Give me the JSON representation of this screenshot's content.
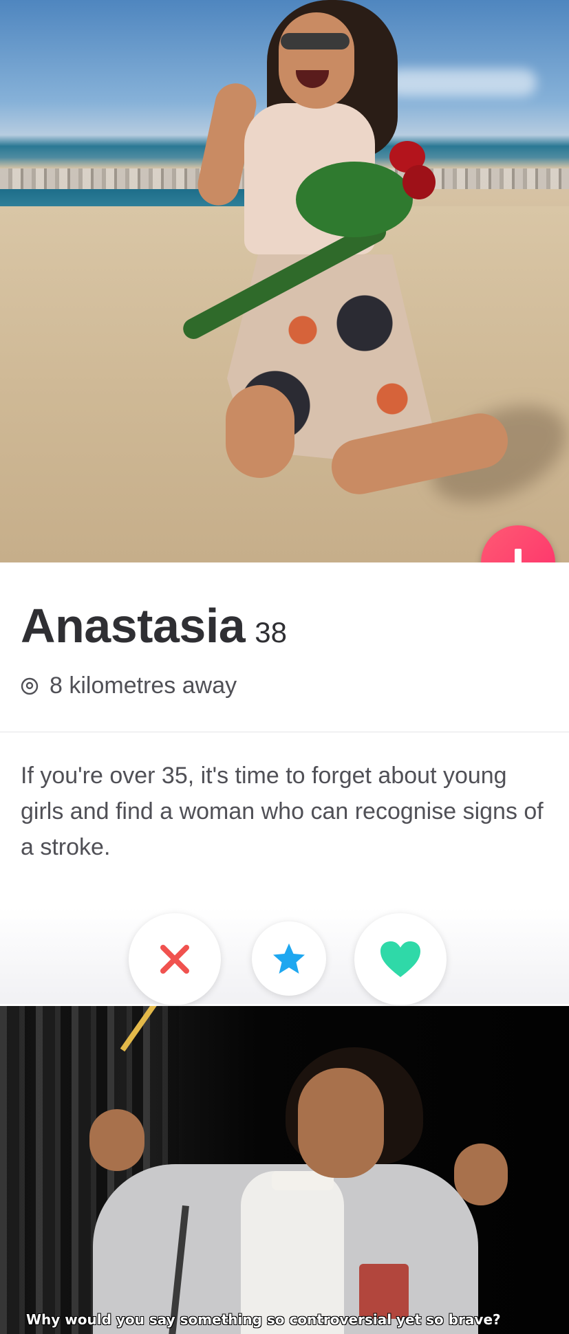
{
  "profile": {
    "name": "Anastasia",
    "age": "38",
    "distance": "8 kilometres away",
    "bio": "If you're over 35, it's time to forget about young girls and find a woman who can recognise signs of a stroke."
  },
  "actions": {
    "info_icon": "arrow-down-icon",
    "nope_icon": "close-icon",
    "superlike_icon": "star-icon",
    "like_icon": "heart-icon"
  },
  "meme": {
    "caption": "Why would you say something so controversial yet so brave?"
  },
  "colors": {
    "brand_gradient_start": "#ff5a73",
    "brand_gradient_end": "#fd2f6b",
    "nope": "#f0524f",
    "superlike": "#1ea7f0",
    "like": "#2fd9a8",
    "name_text": "#2f2f33",
    "body_text": "#505056"
  }
}
